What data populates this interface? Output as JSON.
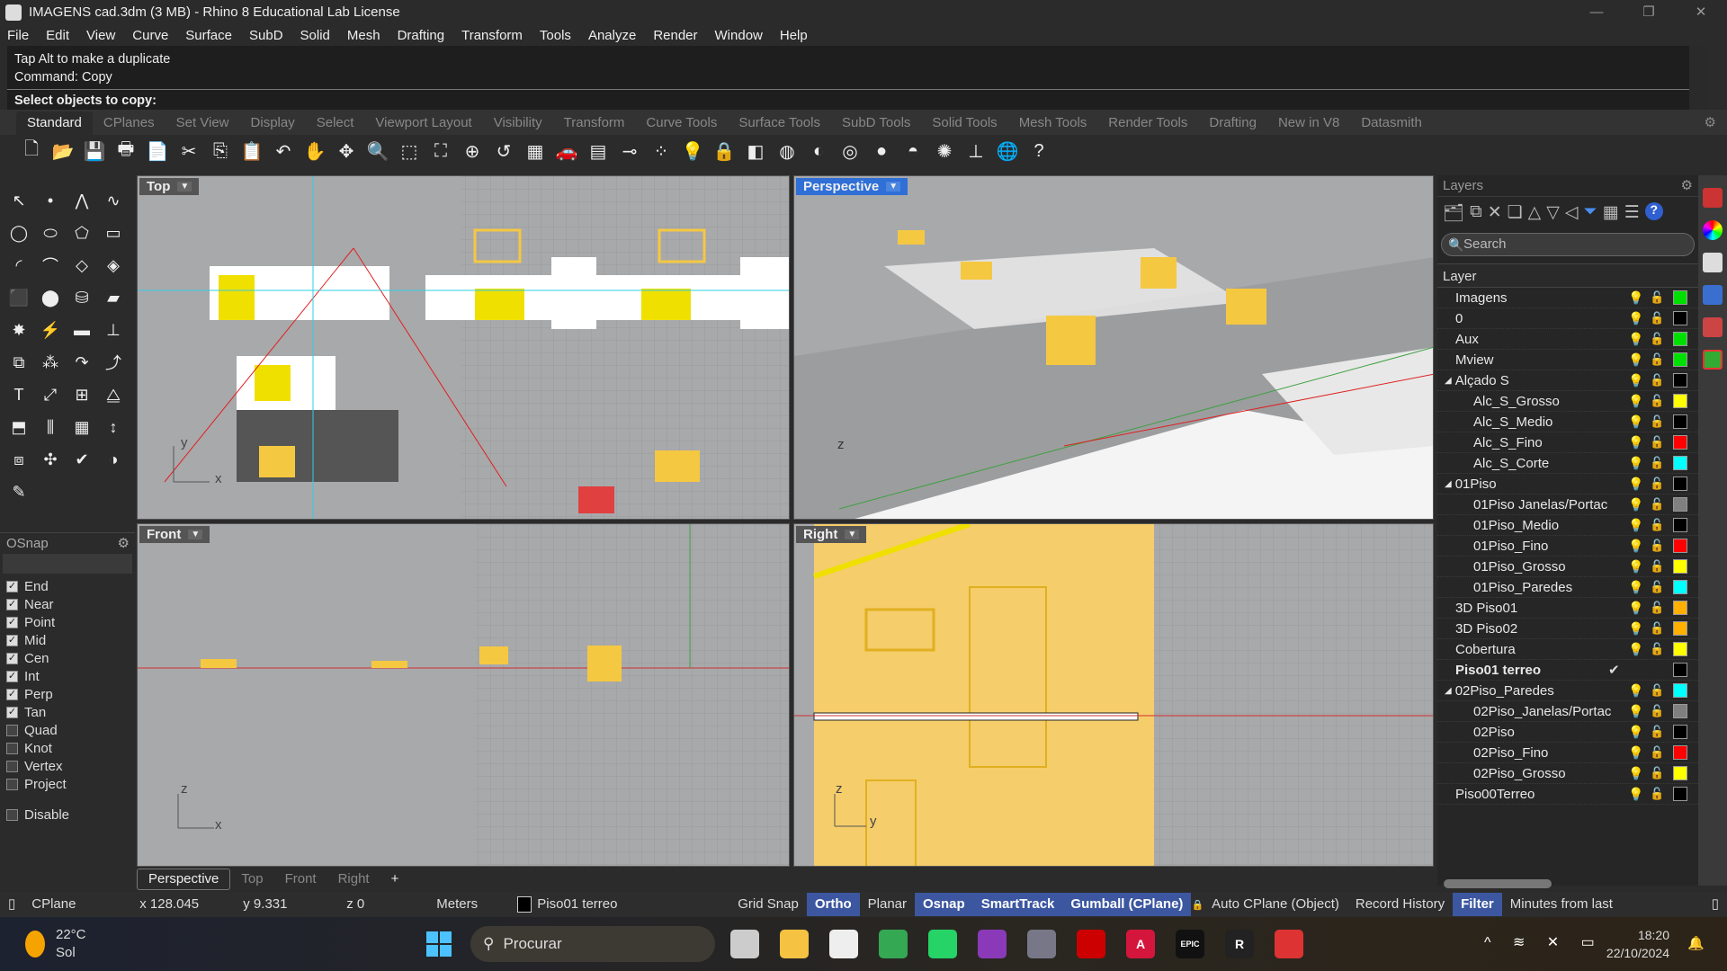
{
  "window": {
    "title": "IMAGENS cad.3dm (3 MB) - Rhino 8 Educational Lab License",
    "minimize": "—",
    "maximize": "❐",
    "close": "✕"
  },
  "menu": [
    "File",
    "Edit",
    "View",
    "Curve",
    "Surface",
    "SubD",
    "Solid",
    "Mesh",
    "Drafting",
    "Transform",
    "Tools",
    "Analyze",
    "Render",
    "Window",
    "Help"
  ],
  "command": {
    "history": [
      "Tap Alt to make a duplicate",
      "Command: Copy"
    ],
    "prompt": "Select objects to copy:"
  },
  "toolbar_tabs": [
    "Standard",
    "CPlanes",
    "Set View",
    "Display",
    "Select",
    "Viewport Layout",
    "Visibility",
    "Transform",
    "Curve Tools",
    "Surface Tools",
    "SubD Tools",
    "Solid Tools",
    "Mesh Tools",
    "Render Tools",
    "Drafting",
    "New in V8",
    "Datasmith"
  ],
  "active_toolbar_tab": "Standard",
  "toolbar_icons": [
    [
      "new-icon",
      "🗋"
    ],
    [
      "open-icon",
      "📂"
    ],
    [
      "save-icon",
      "💾"
    ],
    [
      "print-icon",
      "🖶"
    ],
    [
      "import-icon",
      "📄"
    ],
    [
      "cut-icon",
      "✂"
    ],
    [
      "copy-icon",
      "⎘"
    ],
    [
      "paste-icon",
      "📋"
    ],
    [
      "undo-icon",
      "↶"
    ],
    [
      "pan-icon",
      "✋"
    ],
    [
      "rotate-view-icon",
      "✥"
    ],
    [
      "zoom-icon",
      "🔍"
    ],
    [
      "zoom-window-icon",
      "⬚"
    ],
    [
      "zoom-extents-icon",
      "⛶"
    ],
    [
      "zoom-selected-icon",
      "⊕"
    ],
    [
      "undo-view-icon",
      "↺"
    ],
    [
      "four-viewports-icon",
      "▦"
    ],
    [
      "car-icon",
      "🚗"
    ],
    [
      "grid-icon",
      "▤"
    ],
    [
      "osnap-icon",
      "⊸"
    ],
    [
      "points-icon",
      "⁘"
    ],
    [
      "light-icon",
      "💡"
    ],
    [
      "lock-icon",
      "🔒"
    ],
    [
      "layer-icon",
      "◧"
    ],
    [
      "color-wheel-icon",
      "◍"
    ],
    [
      "shaded-icon",
      "◐"
    ],
    [
      "wireframe-icon",
      "◎"
    ],
    [
      "rendered-icon",
      "●"
    ],
    [
      "render-icon",
      "◓"
    ],
    [
      "sun-icon",
      "✺"
    ],
    [
      "dimension-icon",
      "⊥"
    ],
    [
      "globe-icon",
      "🌐"
    ],
    [
      "help-icon",
      "?"
    ]
  ],
  "toolbox_icons": [
    [
      "select-icon",
      "↖"
    ],
    [
      "point-icon",
      "•"
    ],
    [
      "polyline-icon",
      "⋀"
    ],
    [
      "curve-icon",
      "∿"
    ],
    [
      "circle-icon",
      "◯"
    ],
    [
      "ellipse-icon",
      "⬭"
    ],
    [
      "polygon-icon",
      "⬠"
    ],
    [
      "rectangle-icon",
      "▭"
    ],
    [
      "arc-icon",
      "◜"
    ],
    [
      "fillet-icon",
      "⌒"
    ],
    [
      "surface-icon",
      "◇"
    ],
    [
      "sweep-icon",
      "◈"
    ],
    [
      "box-icon",
      "⬛"
    ],
    [
      "sphere-icon",
      "⬤"
    ],
    [
      "cylinder-icon",
      "⛁"
    ],
    [
      "loft-icon",
      "▰"
    ],
    [
      "explode-icon",
      "✸"
    ],
    [
      "trim-icon",
      "⚡"
    ],
    [
      "extend-icon",
      "▬"
    ],
    [
      "split-icon",
      "⊥"
    ],
    [
      "boolean-icon",
      "⧉"
    ],
    [
      "group-icon",
      "⁂"
    ],
    [
      "move-icon",
      "↷"
    ],
    [
      "offset-icon",
      "⤴"
    ],
    [
      "text-icon",
      "T"
    ],
    [
      "scale-icon",
      "⤢"
    ],
    [
      "array-icon",
      "⊞"
    ],
    [
      "mirror-icon",
      "⧋"
    ],
    [
      "extrude-icon",
      "⬒"
    ],
    [
      "contour-icon",
      "⫼"
    ],
    [
      "mesh-icon",
      "▦"
    ],
    [
      "dimension-icon",
      "↕"
    ],
    [
      "clipping-icon",
      "⧈"
    ],
    [
      "gumball-icon",
      "✣"
    ],
    [
      "check-icon",
      "✔"
    ],
    [
      "analyze-icon",
      "◑"
    ],
    [
      "paint-icon",
      "✎"
    ]
  ],
  "osnap": {
    "title": "OSnap",
    "items": [
      {
        "label": "End",
        "checked": true
      },
      {
        "label": "Near",
        "checked": true
      },
      {
        "label": "Point",
        "checked": true
      },
      {
        "label": "Mid",
        "checked": true
      },
      {
        "label": "Cen",
        "checked": true
      },
      {
        "label": "Int",
        "checked": true
      },
      {
        "label": "Perp",
        "checked": true
      },
      {
        "label": "Tan",
        "checked": true
      },
      {
        "label": "Quad",
        "checked": false
      },
      {
        "label": "Knot",
        "checked": false
      },
      {
        "label": "Vertex",
        "checked": false
      },
      {
        "label": "Project",
        "checked": false
      }
    ],
    "disable": {
      "label": "Disable",
      "checked": false
    }
  },
  "viewports": {
    "top": "Top",
    "perspective": "Perspective",
    "front": "Front",
    "right": "Right"
  },
  "axes": {
    "x": "x",
    "y": "y",
    "z": "z"
  },
  "layers": {
    "title": "Layers",
    "search_placeholder": "Search",
    "column": "Layer",
    "tool_icons": [
      [
        "new-layer-icon",
        "🗂"
      ],
      [
        "new-sublayer-icon",
        "⧉"
      ],
      [
        "delete-icon",
        "✕"
      ],
      [
        "duplicate-icon",
        "❏"
      ],
      [
        "move-up-icon",
        "△"
      ],
      [
        "move-down-icon",
        "▽"
      ],
      [
        "move-left-icon",
        "◁"
      ],
      [
        "filter-icon",
        "⏷"
      ],
      [
        "grid-icon",
        "▦"
      ],
      [
        "menu-icon",
        "☰"
      ],
      [
        "help-icon",
        "?"
      ]
    ],
    "rows": [
      {
        "name": "Imagens",
        "level": 0,
        "color": "#00e000"
      },
      {
        "name": "0",
        "level": 0,
        "color": "#000000"
      },
      {
        "name": "Aux",
        "level": 0,
        "color": "#00e000"
      },
      {
        "name": "Mview",
        "level": 0,
        "color": "#00e000"
      },
      {
        "name": "Alçado S",
        "level": 0,
        "expanded": true,
        "color": "#000000"
      },
      {
        "name": "Alc_S_Grosso",
        "level": 1,
        "color": "#ffff00"
      },
      {
        "name": "Alc_S_Medio",
        "level": 1,
        "color": "#000000"
      },
      {
        "name": "Alc_S_Fino",
        "level": 1,
        "color": "#ff0000"
      },
      {
        "name": "Alc_S_Corte",
        "level": 1,
        "color": "#00ffff"
      },
      {
        "name": "01Piso",
        "level": 0,
        "expanded": true,
        "color": "#000000"
      },
      {
        "name": "01Piso Janelas/Portac",
        "level": 1,
        "color": "#808080"
      },
      {
        "name": "01Piso_Medio",
        "level": 1,
        "color": "#000000"
      },
      {
        "name": "01Piso_Fino",
        "level": 1,
        "color": "#ff0000"
      },
      {
        "name": "01Piso_Grosso",
        "level": 1,
        "color": "#ffff00"
      },
      {
        "name": "01Piso_Paredes",
        "level": 1,
        "color": "#00ffff"
      },
      {
        "name": "3D Piso01",
        "level": 0,
        "color": "#ffb000"
      },
      {
        "name": "3D Piso02",
        "level": 0,
        "color": "#ffb000"
      },
      {
        "name": "Cobertura",
        "level": 0,
        "color": "#ffff00"
      },
      {
        "name": "Piso01 terreo",
        "level": 0,
        "current": true,
        "color": "#000000"
      },
      {
        "name": "02Piso_Paredes",
        "level": 0,
        "expanded": true,
        "color": "#00ffff"
      },
      {
        "name": "02Piso_Janelas/Portac",
        "level": 1,
        "color": "#808080"
      },
      {
        "name": "02Piso",
        "level": 1,
        "color": "#000000"
      },
      {
        "name": "02Piso_Fino",
        "level": 1,
        "color": "#ff0000"
      },
      {
        "name": "02Piso_Grosso",
        "level": 1,
        "color": "#ffff00"
      },
      {
        "name": "Piso00Terreo",
        "level": 0,
        "color": "#000000"
      }
    ]
  },
  "viewport_tabs": [
    "Perspective",
    "Top",
    "Front",
    "Right",
    "+"
  ],
  "active_viewport_tab": "Perspective",
  "status": {
    "cplane": "CPlane",
    "x": "x 128.045",
    "y": "y 9.331",
    "z": "z 0",
    "units": "Meters",
    "layer": "Piso01 terreo",
    "toggles": [
      {
        "label": "Grid Snap",
        "on": false
      },
      {
        "label": "Ortho",
        "on": true
      },
      {
        "label": "Planar",
        "on": false
      },
      {
        "label": "Osnap",
        "on": true
      },
      {
        "label": "SmartTrack",
        "on": true
      },
      {
        "label": "Gumball (CPlane)",
        "on": true
      },
      {
        "label": "Auto CPlane (Object)",
        "on": false
      },
      {
        "label": "Record History",
        "on": false
      },
      {
        "label": "Filter",
        "on": true
      },
      {
        "label": "Minutes from last",
        "on": false
      }
    ]
  },
  "taskbar": {
    "weather_temp": "22°C",
    "weather_desc": "Sol",
    "search": "Procurar",
    "time": "18:20",
    "date": "22/10/2024",
    "apps": [
      [
        "task-view",
        "#ccc",
        ""
      ],
      [
        "file-explorer",
        "#f5c242",
        ""
      ],
      [
        "microsoft-store",
        "#eee",
        ""
      ],
      [
        "chrome",
        "#34a853",
        ""
      ],
      [
        "whatsapp",
        "#25d366",
        ""
      ],
      [
        "instagram",
        "#8a3ab9",
        ""
      ],
      [
        "settings",
        "#778",
        ""
      ],
      [
        "autodesk",
        "#c00",
        ""
      ],
      [
        "autocad",
        "#d5163c",
        "A"
      ],
      [
        "epic-games",
        "#111",
        "EPIC"
      ],
      [
        "rhino",
        "#222",
        "R"
      ],
      [
        "sketchup",
        "#d33",
        ""
      ]
    ]
  },
  "colors": {
    "accent": "#2f6fd6",
    "status_highlight": "#3c57a0",
    "viewport_bg": "#a8a9ab",
    "geometry_yellow": "#f5c842"
  }
}
